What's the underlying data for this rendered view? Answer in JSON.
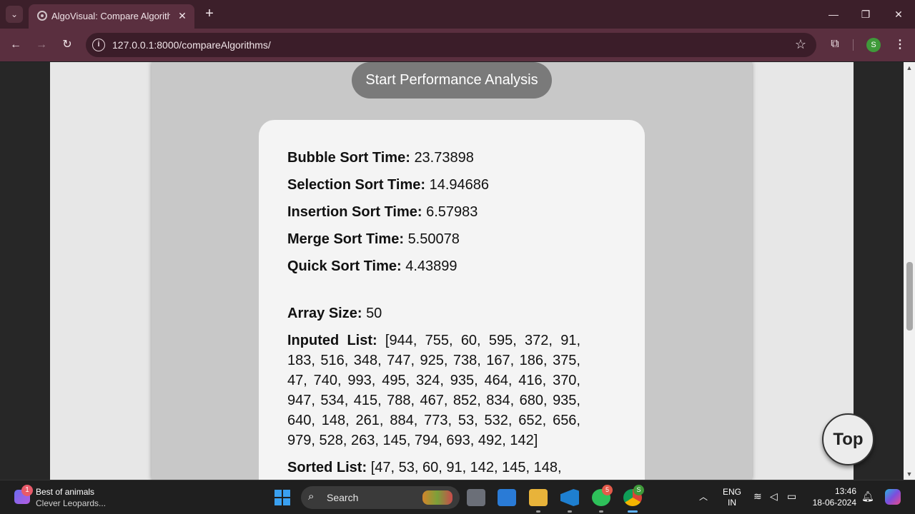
{
  "browser": {
    "tab_title": "AlgoVisual: Compare Algorithms",
    "close_glyph": "✕",
    "new_tab_glyph": "+",
    "url": "127.0.0.1:8000/compareAlgorithms/",
    "profile_initial": "S"
  },
  "page": {
    "start_button": "Start Performance Analysis",
    "results": [
      {
        "label": "Bubble Sort Time:",
        "value": "23.73898"
      },
      {
        "label": "Selection Sort Time:",
        "value": "14.94686"
      },
      {
        "label": "Insertion Sort Time:",
        "value": "6.57983"
      },
      {
        "label": "Merge Sort Time:",
        "value": "5.50078"
      },
      {
        "label": "Quick Sort Time:",
        "value": "4.43899"
      }
    ],
    "array_size": {
      "label": "Array Size:",
      "value": "50"
    },
    "inputed_list": {
      "label": "Inputed List:",
      "value": "[944, 755, 60, 595, 372, 91, 183, 516, 348, 747, 925, 738, 167, 186, 375, 47, 740, 993, 495, 324, 935, 464, 416, 370, 947, 534, 415, 788, 467, 852, 834, 680, 935, 640, 148, 261, 884, 773, 53, 532, 652, 656, 979, 528, 263, 145, 794, 693, 492, 142]"
    },
    "sorted_list": {
      "label": "Sorted List:",
      "value": "[47, 53, 60, 91, 142, 145, 148,"
    },
    "top_button": "Top"
  },
  "taskbar": {
    "widget_badge": "1",
    "widget_title": "Best of animals",
    "widget_subtitle": "Clever Leopards...",
    "search_placeholder": "Search",
    "whatsapp_badge": "5",
    "chrome_badge": "S",
    "lang_line1": "ENG",
    "lang_line2": "IN",
    "time": "13:46",
    "date": "18-06-2024"
  }
}
